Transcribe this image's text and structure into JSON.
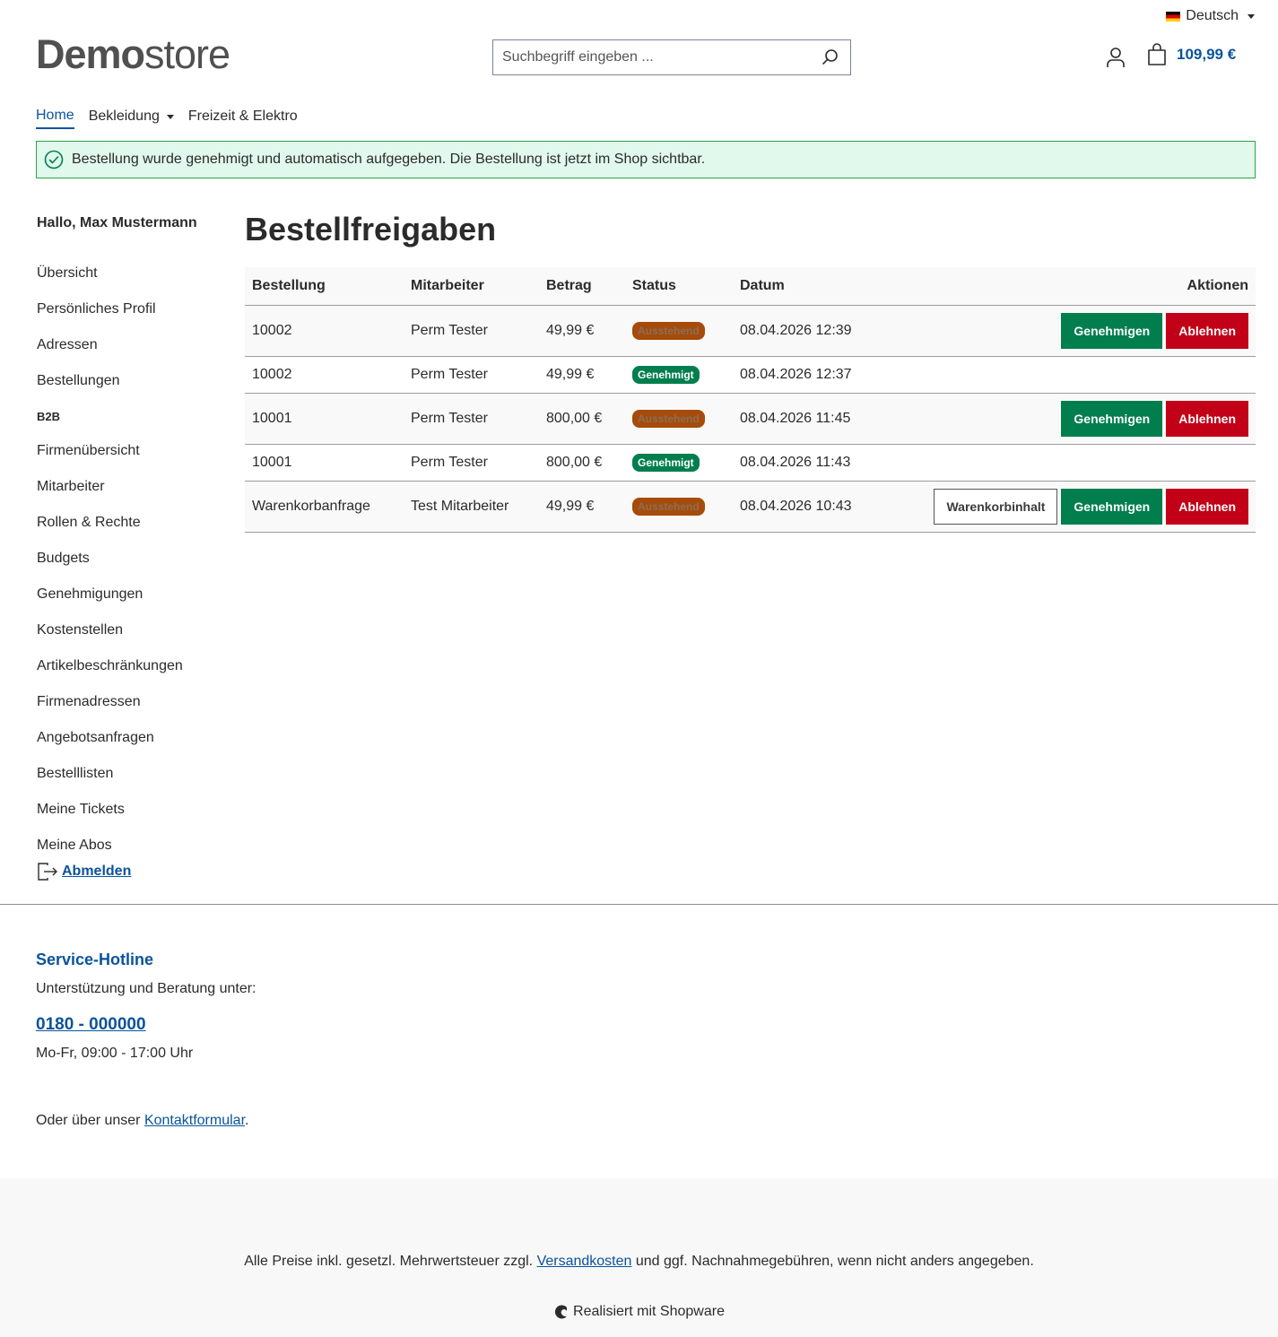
{
  "header": {
    "language": "Deutsch",
    "logo_bold": "Demo",
    "logo_light": "store",
    "search_placeholder": "Suchbegriff eingeben ...",
    "cart_total": "109,99 €"
  },
  "nav": {
    "items": [
      {
        "label": "Home"
      },
      {
        "label": "Bekleidung"
      },
      {
        "label": "Freizeit & Elektro"
      }
    ]
  },
  "alert": {
    "message": "Bestellung wurde genehmigt und automatisch aufgegeben. Die Bestellung ist jetzt im Shop sichtbar."
  },
  "sidebar": {
    "greeting": "Hallo, Max Mustermann",
    "items": [
      "Übersicht",
      "Persönliches Profil",
      "Adressen",
      "Bestellungen"
    ],
    "b2b_heading": "B2B",
    "b2b_items": [
      "Firmenübersicht",
      "Mitarbeiter",
      "Rollen & Rechte",
      "Budgets",
      "Genehmigungen",
      "Kostenstellen",
      "Artikelbeschränkungen",
      "Firmenadressen",
      "Angebotsanfragen",
      "Bestelllisten",
      "Meine Tickets",
      "Meine Abos"
    ],
    "logout": "Abmelden"
  },
  "main": {
    "title": "Bestellfreigaben",
    "columns": [
      "Bestellung",
      "Mitarbeiter",
      "Betrag",
      "Status",
      "Datum",
      "Aktionen"
    ],
    "rows": [
      {
        "order": "10002",
        "employee": "Perm Tester",
        "amount": "49,99 €",
        "status": "Ausstehend",
        "date": "08.04.2026 12:39"
      },
      {
        "order": "10002",
        "employee": "Perm Tester",
        "amount": "49,99 €",
        "status": "Genehmigt",
        "date": "08.04.2026 12:37"
      },
      {
        "order": "10001",
        "employee": "Perm Tester",
        "amount": "800,00 €",
        "status": "Ausstehend",
        "date": "08.04.2026 11:45"
      },
      {
        "order": "10001",
        "employee": "Perm Tester",
        "amount": "800,00 €",
        "status": "Genehmigt",
        "date": "08.04.2026 11:43"
      },
      {
        "order": "Warenkorbanfrage",
        "employee": "Test Mitarbeiter",
        "amount": "49,99 €",
        "status": "Ausstehend",
        "date": "08.04.2026 10:43"
      }
    ],
    "approve_label": "Genehmigen",
    "reject_label": "Ablehnen",
    "cart_content_label": "Warenkorbinhalt"
  },
  "footer": {
    "hotline_title": "Service-Hotline",
    "hotline_sub": "Unterstützung und Beratung unter:",
    "phone": "0180 - 000000",
    "hours": "Mo-Fr, 09:00 - 17:00 Uhr",
    "contact_prefix": "Oder über unser ",
    "contact_link": "Kontaktformular",
    "contact_suffix": ".",
    "vat_prefix": "Alle Preise inkl. gesetzl. Mehrwertsteuer zzgl. ",
    "vat_link": "Versandkosten",
    "vat_suffix": " und ggf. Nachnahmegebühren, wenn nicht anders angegeben.",
    "powered": "Realisiert mit Shopware"
  },
  "colors": {
    "primary": "#0b539b",
    "success": "#007e4e",
    "danger": "#c20017",
    "pending": "#a64b09",
    "alert_bg": "#e1f8ec"
  }
}
